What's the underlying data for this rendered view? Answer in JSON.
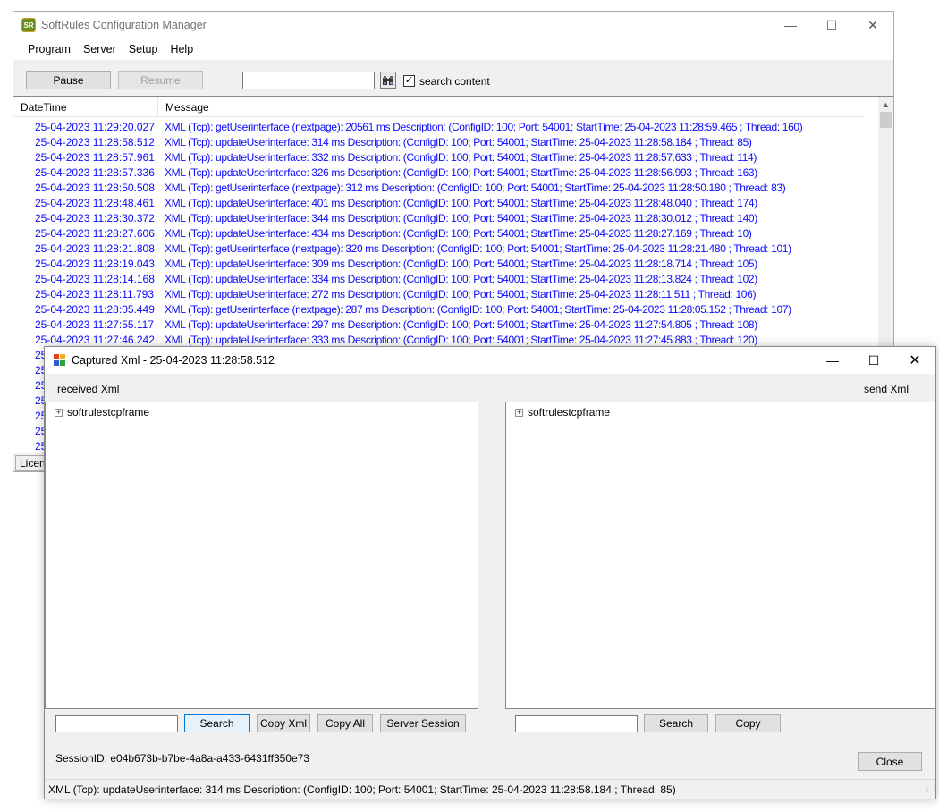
{
  "main_window": {
    "title": "SoftRules Configuration Manager",
    "app_icon_text": "SR",
    "menu": [
      "Program",
      "Server",
      "Setup",
      "Help"
    ],
    "toolbar": {
      "pause_label": "Pause",
      "resume_label": "Resume",
      "search_value": "",
      "search_content_label": "search content",
      "search_content_checked": true
    },
    "log": {
      "columns": [
        "DateTime",
        "Message"
      ],
      "rows": [
        {
          "datetime": "25-04-2023 11:29:20.027",
          "message": "XML (Tcp): getUserinterface (nextpage): 20561 ms Description:  (ConfigID: 100; Port: 54001; StartTime: 25-04-2023 11:28:59.465 ; Thread: 160)"
        },
        {
          "datetime": "25-04-2023 11:28:58.512",
          "message": "XML (Tcp): updateUserinterface: 314 ms Description:  (ConfigID: 100; Port: 54001; StartTime: 25-04-2023 11:28:58.184 ; Thread: 85)"
        },
        {
          "datetime": "25-04-2023 11:28:57.961",
          "message": "XML (Tcp): updateUserinterface: 332 ms Description:  (ConfigID: 100; Port: 54001; StartTime: 25-04-2023 11:28:57.633 ; Thread: 114)"
        },
        {
          "datetime": "25-04-2023 11:28:57.336",
          "message": "XML (Tcp): updateUserinterface: 326 ms Description:  (ConfigID: 100; Port: 54001; StartTime: 25-04-2023 11:28:56.993 ; Thread: 163)"
        },
        {
          "datetime": "25-04-2023 11:28:50.508",
          "message": "XML (Tcp): getUserinterface (nextpage): 312 ms Description:  (ConfigID: 100; Port: 54001; StartTime: 25-04-2023 11:28:50.180 ; Thread: 83)"
        },
        {
          "datetime": "25-04-2023 11:28:48.461",
          "message": "XML (Tcp): updateUserinterface: 401 ms Description:  (ConfigID: 100; Port: 54001; StartTime: 25-04-2023 11:28:48.040 ; Thread: 174)"
        },
        {
          "datetime": "25-04-2023 11:28:30.372",
          "message": "XML (Tcp): updateUserinterface: 344 ms Description:  (ConfigID: 100; Port: 54001; StartTime: 25-04-2023 11:28:30.012 ; Thread: 140)"
        },
        {
          "datetime": "25-04-2023 11:28:27.606",
          "message": "XML (Tcp): updateUserinterface: 434 ms Description:  (ConfigID: 100; Port: 54001; StartTime: 25-04-2023 11:28:27.169 ; Thread: 10)"
        },
        {
          "datetime": "25-04-2023 11:28:21.808",
          "message": "XML (Tcp): getUserinterface (nextpage): 320 ms Description:  (ConfigID: 100; Port: 54001; StartTime: 25-04-2023 11:28:21.480 ; Thread: 101)"
        },
        {
          "datetime": "25-04-2023 11:28:19.043",
          "message": "XML (Tcp): updateUserinterface: 309 ms Description:  (ConfigID: 100; Port: 54001; StartTime: 25-04-2023 11:28:18.714 ; Thread: 105)"
        },
        {
          "datetime": "25-04-2023 11:28:14.168",
          "message": "XML (Tcp): updateUserinterface: 334 ms Description:  (ConfigID: 100; Port: 54001; StartTime: 25-04-2023 11:28:13.824 ; Thread: 102)"
        },
        {
          "datetime": "25-04-2023 11:28:11.793",
          "message": "XML (Tcp): updateUserinterface: 272 ms Description:  (ConfigID: 100; Port: 54001; StartTime: 25-04-2023 11:28:11.511 ; Thread: 106)"
        },
        {
          "datetime": "25-04-2023 11:28:05.449",
          "message": "XML (Tcp): getUserinterface (nextpage): 287 ms Description:  (ConfigID: 100; Port: 54001; StartTime: 25-04-2023 11:28:05.152 ; Thread: 107)"
        },
        {
          "datetime": "25-04-2023 11:27:55.117",
          "message": "XML (Tcp): updateUserinterface: 297 ms Description:  (ConfigID: 100; Port: 54001; StartTime: 25-04-2023 11:27:54.805 ; Thread: 108)"
        },
        {
          "datetime": "25-04-2023 11:27:46.242",
          "message": "XML (Tcp): updateUserinterface: 333 ms Description:  (ConfigID: 100; Port: 54001; StartTime: 25-04-2023 11:27:45.883 ; Thread: 120)"
        },
        {
          "datetime": "25",
          "message": ""
        },
        {
          "datetime": "25",
          "message": ""
        },
        {
          "datetime": "25",
          "message": ""
        },
        {
          "datetime": "25",
          "message": ""
        },
        {
          "datetime": "25",
          "message": ""
        },
        {
          "datetime": "25",
          "message": ""
        },
        {
          "datetime": "25",
          "message": ""
        }
      ]
    },
    "license_tab": "Licen"
  },
  "dialog": {
    "title": "Captured Xml - 25-04-2023 11:28:58.512",
    "received_label": "received Xml",
    "send_label": "send Xml",
    "left_tree_root": "softrulestcpframe",
    "right_tree_root": "softrulestcpframe",
    "left_search_value": "",
    "right_search_value": "",
    "buttons": {
      "search": "Search",
      "copy_xml": "Copy Xml",
      "copy_all": "Copy All",
      "server_session": "Server Session",
      "search_right": "Search",
      "copy": "Copy",
      "close": "Close"
    },
    "session_id": "SessionID: e04b673b-b7be-4a8a-a433-6431ff350e73",
    "status": "XML (Tcp): updateUserinterface: 314 ms Description:  (ConfigID: 100; Port: 54001; StartTime: 25-04-2023 11:28:58.184 ; Thread: 85)"
  },
  "colors": {
    "log_text": "#0a0aff",
    "focus_border": "#0078d7",
    "window_bg": "#f0f0f0"
  }
}
